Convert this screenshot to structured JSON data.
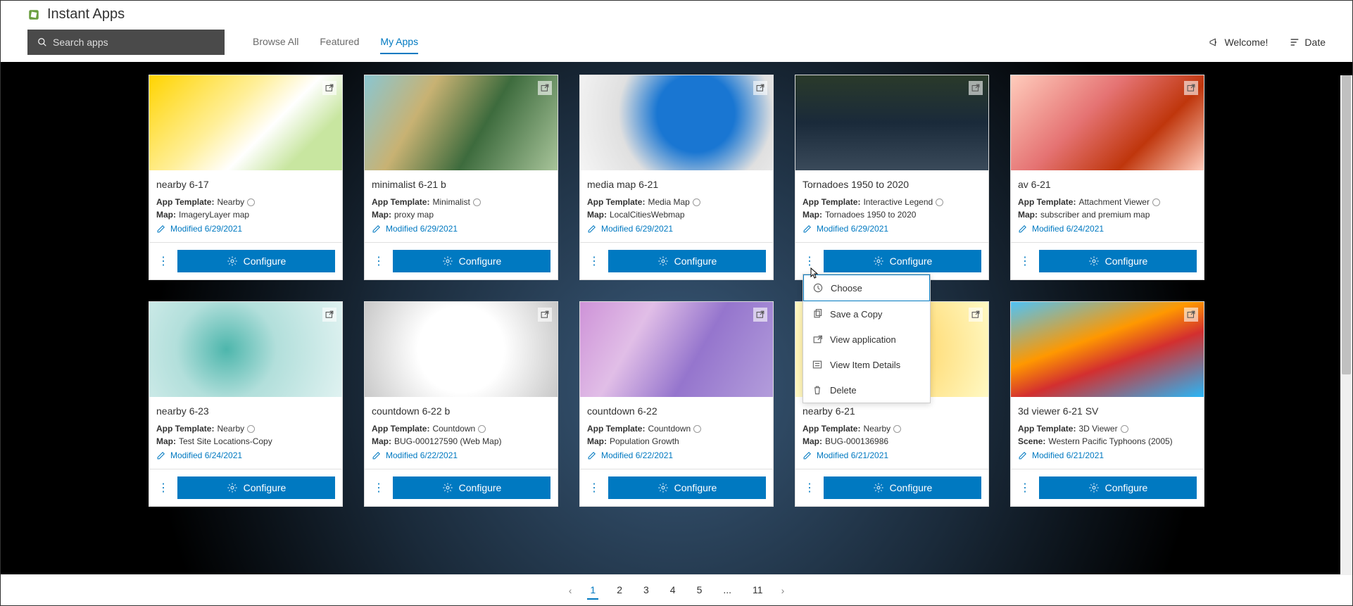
{
  "header": {
    "app_title": "Instant Apps",
    "search_placeholder": "Search apps",
    "tabs": [
      {
        "label": "Browse All",
        "active": false
      },
      {
        "label": "Featured",
        "active": false
      },
      {
        "label": "My Apps",
        "active": true
      }
    ],
    "welcome_label": "Welcome!",
    "sort_label": "Date"
  },
  "labels": {
    "app_template": "App Template:",
    "map": "Map:",
    "scene": "Scene:",
    "modified": "Modified",
    "configure": "Configure"
  },
  "cards": [
    {
      "title": "nearby 6-17",
      "template": "Nearby",
      "source_key": "map",
      "source_value": "ImageryLayer map",
      "modified": "6/29/2021",
      "thumb": "tn1"
    },
    {
      "title": "minimalist 6-21 b",
      "template": "Minimalist",
      "source_key": "map",
      "source_value": "proxy map",
      "modified": "6/29/2021",
      "thumb": "tn2"
    },
    {
      "title": "media map 6-21",
      "template": "Media Map",
      "source_key": "map",
      "source_value": "LocalCitiesWebmap",
      "modified": "6/29/2021",
      "thumb": "tn3"
    },
    {
      "title": "Tornadoes 1950 to 2020",
      "template": "Interactive Legend",
      "source_key": "map",
      "source_value": "Tornadoes 1950 to 2020",
      "modified": "6/29/2021",
      "thumb": "tn4",
      "dropdown_open": true
    },
    {
      "title": "av 6-21",
      "template": "Attachment Viewer",
      "source_key": "map",
      "source_value": "subscriber and premium map",
      "modified": "6/24/2021",
      "thumb": "tn5"
    },
    {
      "title": "nearby 6-23",
      "template": "Nearby",
      "source_key": "map",
      "source_value": "Test Site Locations-Copy",
      "modified": "6/24/2021",
      "thumb": "tn6"
    },
    {
      "title": "countdown 6-22 b",
      "template": "Countdown",
      "source_key": "map",
      "source_value": "BUG-000127590 (Web Map)",
      "modified": "6/22/2021",
      "thumb": "tn7"
    },
    {
      "title": "countdown 6-22",
      "template": "Countdown",
      "source_key": "map",
      "source_value": "Population Growth",
      "modified": "6/22/2021",
      "thumb": "tn8"
    },
    {
      "title": "nearby 6-21",
      "template": "Nearby",
      "source_key": "map",
      "source_value": "BUG-000136986",
      "modified": "6/21/2021",
      "thumb": "tn9"
    },
    {
      "title": "3d viewer 6-21 SV",
      "template": "3D Viewer",
      "source_key": "scene",
      "source_value": "Western Pacific Typhoons (2005)",
      "modified": "6/21/2021",
      "thumb": "tn10"
    }
  ],
  "dropdown": {
    "items": [
      {
        "label": "Choose",
        "icon": "choose-icon",
        "highlight": true
      },
      {
        "label": "Save a Copy",
        "icon": "copy-icon"
      },
      {
        "label": "View application",
        "icon": "external-icon"
      },
      {
        "label": "View Item Details",
        "icon": "details-icon"
      },
      {
        "label": "Delete",
        "icon": "trash-icon"
      }
    ]
  },
  "pagination": {
    "pages": [
      "1",
      "2",
      "3",
      "4",
      "5",
      "...",
      "11"
    ],
    "active": "1"
  }
}
